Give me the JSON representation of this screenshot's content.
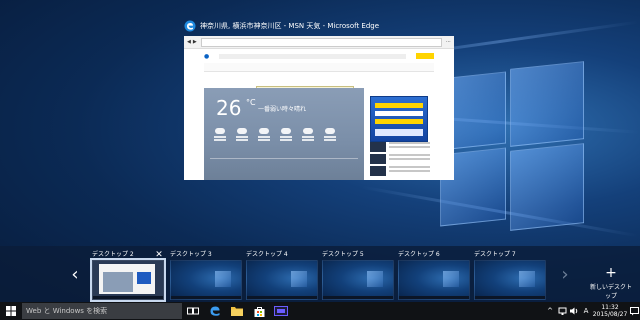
{
  "window_preview": {
    "title": "神奈川県, 横浜市神奈川区 - MSN 天気 - Microsoft Edge",
    "weather": {
      "temperature": "26",
      "unit": "°C",
      "condition": "一番弱い時々晴れ"
    }
  },
  "task_view": {
    "desktops": [
      {
        "label": "デスクトップ 2",
        "active": true
      },
      {
        "label": "デスクトップ 3",
        "active": false
      },
      {
        "label": "デスクトップ 4",
        "active": false
      },
      {
        "label": "デスクトップ 5",
        "active": false
      },
      {
        "label": "デスクトップ 6",
        "active": false
      },
      {
        "label": "デスクトップ 7",
        "active": false
      }
    ],
    "close_glyph": "✕",
    "prev_glyph": "‹",
    "next_glyph": "›",
    "new_desktop_plus": "+",
    "new_desktop_label": "新しいデスクトップ"
  },
  "taskbar": {
    "search_placeholder": "Web と Windows を検索",
    "ime_indicator": "A",
    "clock": {
      "time": "11:32",
      "date": "2015/08/27"
    }
  },
  "icons": {
    "start": "windows-logo-icon",
    "task_view": "task-view-icon",
    "edge": "edge-icon",
    "explorer": "folder-icon",
    "store": "store-icon",
    "app": "media-app-icon"
  },
  "colors": {
    "taskbar_bg": "#101215",
    "accent": "#1f6fd1",
    "strip_bg": "rgba(10,28,56,.78)"
  }
}
